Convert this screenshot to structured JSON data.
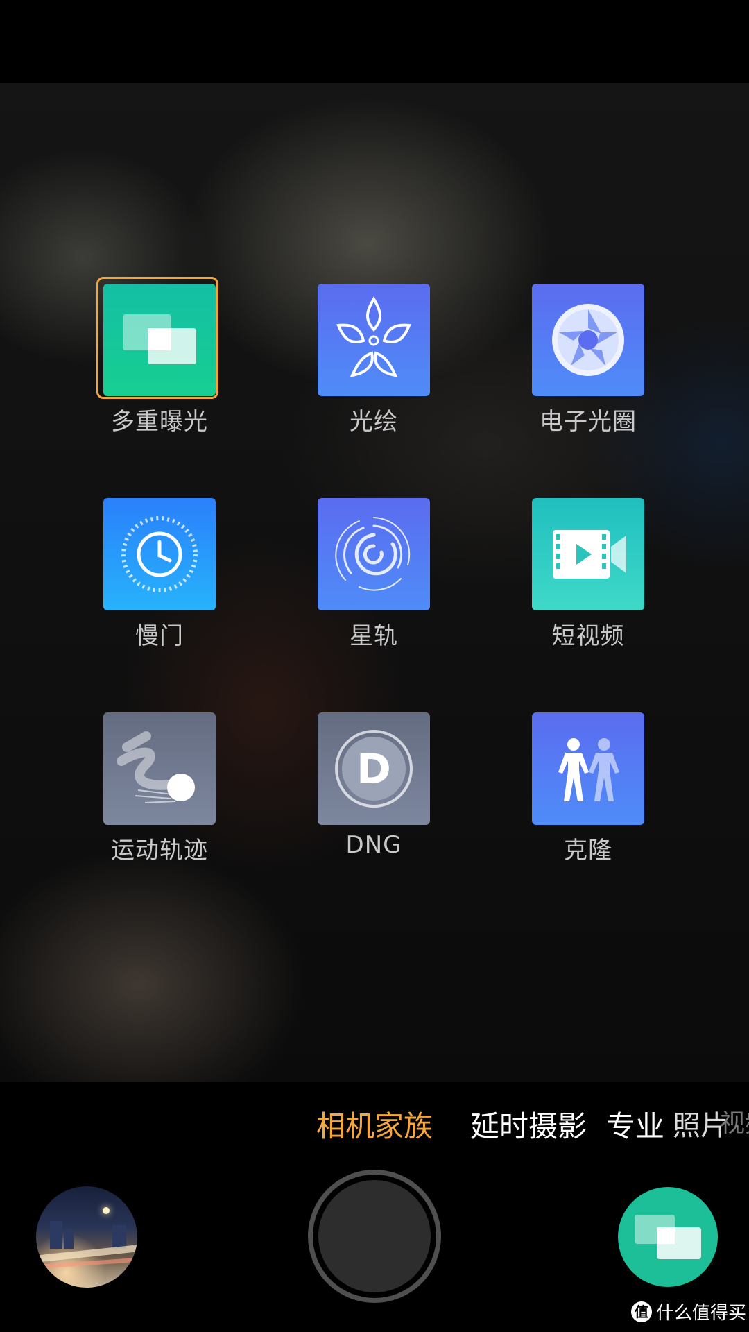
{
  "modes": [
    {
      "label": "多重曝光",
      "icon": "multi-exposure-icon",
      "selected": true
    },
    {
      "label": "光绘",
      "icon": "light-painting-icon",
      "selected": false
    },
    {
      "label": "电子光圈",
      "icon": "aperture-icon",
      "selected": false
    },
    {
      "label": "慢门",
      "icon": "slow-shutter-icon",
      "selected": false
    },
    {
      "label": "星轨",
      "icon": "star-trail-icon",
      "selected": false
    },
    {
      "label": "短视频",
      "icon": "short-video-icon",
      "selected": false
    },
    {
      "label": "运动轨迹",
      "icon": "motion-trail-icon",
      "selected": false
    },
    {
      "label": "DNG",
      "icon": "dng-icon",
      "selected": false
    },
    {
      "label": "克隆",
      "icon": "clone-icon",
      "selected": false
    }
  ],
  "tabs": [
    {
      "label": "相机家族",
      "active": true
    },
    {
      "label": "延时摄影",
      "active": false
    },
    {
      "label": "专业",
      "active": false
    },
    {
      "label": "照片",
      "active": false
    },
    {
      "label": "视频",
      "active": false
    }
  ],
  "watermark": {
    "badge": "值",
    "text": "什么值得买"
  },
  "colors": {
    "accent": "#f5a73b",
    "selector_border": "#f3a43a",
    "mode_shortcut": "#1cbf98"
  }
}
